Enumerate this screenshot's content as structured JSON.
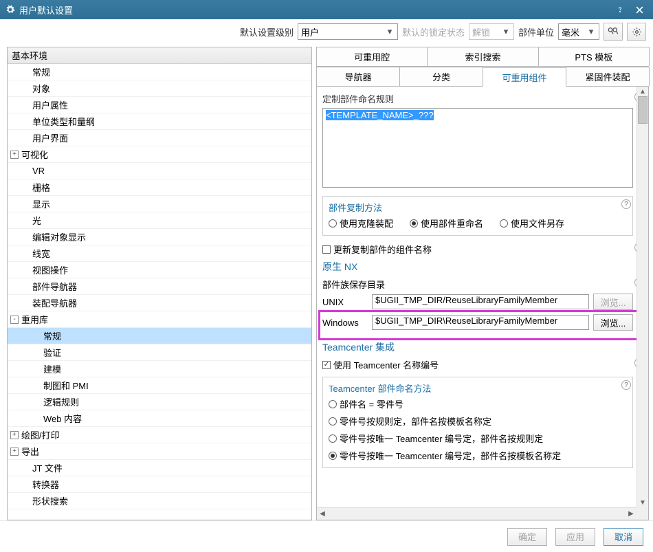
{
  "title": "用户默认设置",
  "toolbar": {
    "level_label": "默认设置级别",
    "level_value": "用户",
    "lock_label": "默认的锁定状态",
    "lock_value": "解锁",
    "unit_label": "部件单位",
    "unit_value": "毫米"
  },
  "tree_header": "基本环境",
  "tree": [
    {
      "label": "常规",
      "indent": 32
    },
    {
      "label": "对象",
      "indent": 32
    },
    {
      "label": "用户属性",
      "indent": 32
    },
    {
      "label": "单位类型和量纲",
      "indent": 32
    },
    {
      "label": "用户界面",
      "indent": 32
    },
    {
      "label": "可视化",
      "indent": 16,
      "toggle": "+"
    },
    {
      "label": "VR",
      "indent": 32
    },
    {
      "label": "栅格",
      "indent": 32
    },
    {
      "label": "显示",
      "indent": 32
    },
    {
      "label": "光",
      "indent": 32
    },
    {
      "label": "编辑对象显示",
      "indent": 32
    },
    {
      "label": "线宽",
      "indent": 32
    },
    {
      "label": "视图操作",
      "indent": 32
    },
    {
      "label": "部件导航器",
      "indent": 32
    },
    {
      "label": "装配导航器",
      "indent": 32
    },
    {
      "label": "重用库",
      "indent": 16,
      "toggle": "-"
    },
    {
      "label": "常规",
      "indent": 48,
      "selected": true
    },
    {
      "label": "验证",
      "indent": 48
    },
    {
      "label": "建模",
      "indent": 48
    },
    {
      "label": "制图和 PMI",
      "indent": 48
    },
    {
      "label": "逻辑规则",
      "indent": 48
    },
    {
      "label": "Web 内容",
      "indent": 48
    },
    {
      "label": "绘图/打印",
      "indent": 16,
      "toggle": "+"
    },
    {
      "label": "导出",
      "indent": 16,
      "toggle": "+"
    },
    {
      "label": "JT 文件",
      "indent": 32
    },
    {
      "label": "转换器",
      "indent": 32
    },
    {
      "label": "形状搜索",
      "indent": 32
    }
  ],
  "tabs_row1": [
    "可重用腔",
    "索引搜索",
    "PTS 模板"
  ],
  "tabs_row2": [
    "导航器",
    "分类",
    "可重用组件",
    "紧固件装配"
  ],
  "active_tab": "可重用组件",
  "custom_rule_label": "定制部件命名规则",
  "custom_rule_value": "<TEMPLATE_NAME>_???",
  "copy_method": {
    "legend": "部件复制方法",
    "options": [
      "使用克隆装配",
      "使用部件重命名",
      "使用文件另存"
    ],
    "selected": "使用部件重命名"
  },
  "update_names": {
    "label": "更新复制部件的组件名称",
    "checked": false
  },
  "native_header": "原生 NX",
  "family_dir_label": "部件族保存目录",
  "dirs": {
    "unix_label": "UNIX",
    "unix_value": "$UGII_TMP_DIR/ReuseLibraryFamilyMember",
    "win_label": "Windows",
    "win_value": "$UGII_TMP_DIR\\ReuseLibraryFamilyMember",
    "browse": "浏览..."
  },
  "tc_header": "Teamcenter 集成",
  "tc_use": {
    "label": "使用 Teamcenter 名称编号",
    "checked": true
  },
  "tc_naming": {
    "legend": "Teamcenter 部件命名方法",
    "options": [
      "部件名 = 零件号",
      "零件号按规则定，部件名按模板名称定",
      "零件号按唯一 Teamcenter 编号定，部件名按规则定",
      "零件号按唯一 Teamcenter 编号定，部件名按模板名称定"
    ],
    "selected": "零件号按唯一 Teamcenter 编号定，部件名按模板名称定"
  },
  "footer": {
    "ok": "确定",
    "apply": "应用",
    "cancel": "取消"
  }
}
